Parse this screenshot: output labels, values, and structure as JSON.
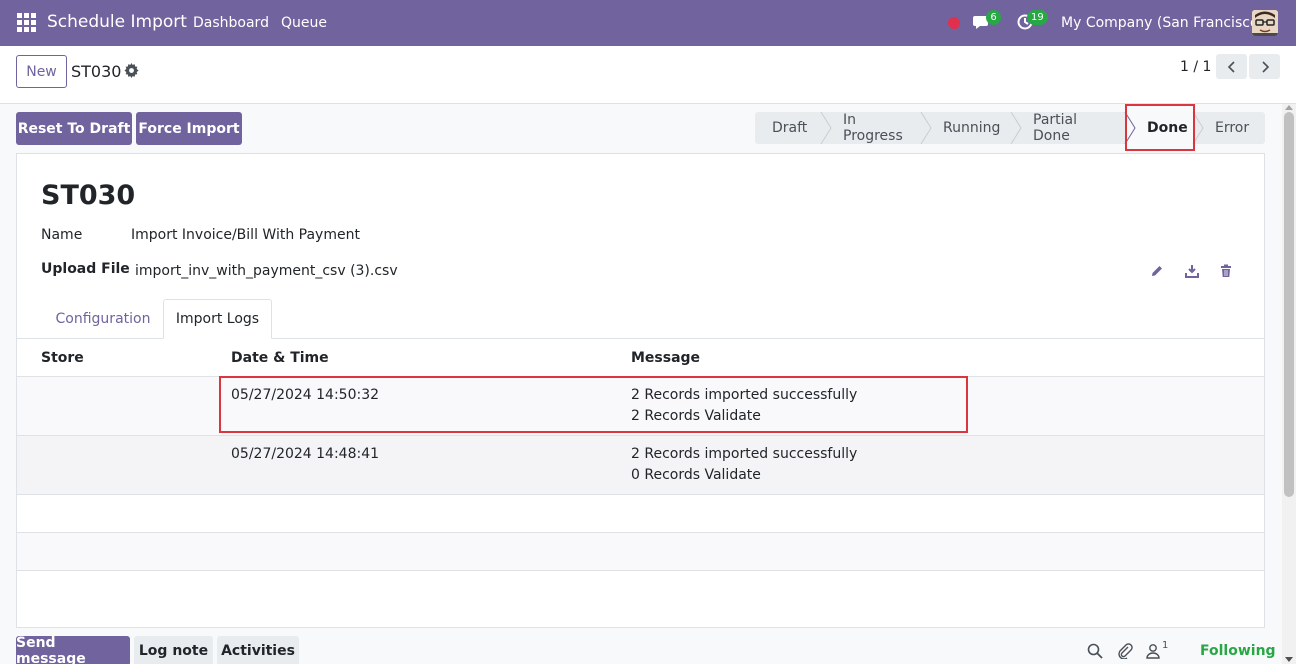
{
  "navbar": {
    "app_title": "Schedule Import",
    "links": [
      "Dashboard",
      "Queue"
    ],
    "messages_count": "6",
    "activities_count": "19",
    "company": "My Company (San Francisco)"
  },
  "control": {
    "new_label": "New",
    "record_title": "ST030",
    "pager": "1 / 1"
  },
  "actions": {
    "reset_label": "Reset To Draft",
    "force_label": "Force Import"
  },
  "statusbar": {
    "stages": [
      "Draft",
      "In Progress",
      "Running",
      "Partial Done",
      "Done",
      "Error"
    ],
    "active": "Done"
  },
  "record": {
    "code": "ST030",
    "name_label": "Name",
    "name_value": "Import Invoice/Bill With Payment",
    "upload_label": "Upload File",
    "upload_value": "import_inv_with_payment_csv (3).csv"
  },
  "tabs": [
    "Configuration",
    "Import Logs"
  ],
  "active_tab": "Import Logs",
  "logs": {
    "columns": [
      "Store",
      "Date & Time",
      "Message"
    ],
    "rows": [
      {
        "store": "",
        "datetime": "05/27/2024 14:50:32",
        "message": [
          "2 Records imported successfully",
          "2 Records Validate"
        ]
      },
      {
        "store": "",
        "datetime": "05/27/2024 14:48:41",
        "message": [
          "2 Records imported successfully",
          "0 Records Validate"
        ]
      }
    ]
  },
  "chatter": {
    "send_message": "Send message",
    "log_note": "Log note",
    "activities": "Activities",
    "followers_count": "1",
    "following": "Following"
  },
  "colors": {
    "brand": "#71639e",
    "highlight": "#d9363e",
    "success": "#28a745"
  }
}
